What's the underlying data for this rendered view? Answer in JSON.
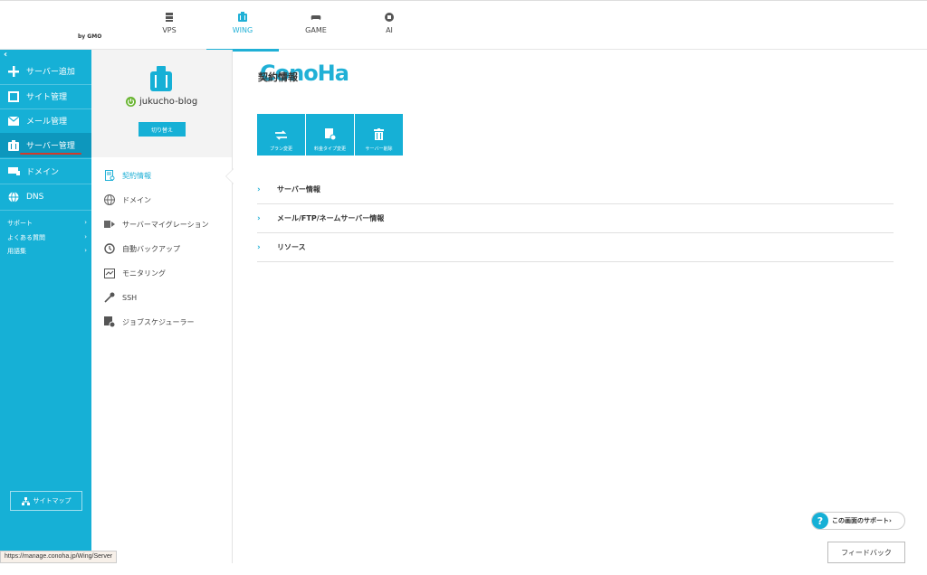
{
  "logo": {
    "text": "ConoHa",
    "sub": "by GMO"
  },
  "top_nav": [
    {
      "label": "VPS",
      "icon": "server-rack-icon"
    },
    {
      "label": "WING",
      "icon": "wing-server-icon",
      "active": true
    },
    {
      "label": "GAME",
      "icon": "gamepad-icon"
    },
    {
      "label": "AI",
      "icon": "ai-chip-icon"
    }
  ],
  "sidebar": {
    "collapse": "‹",
    "items": [
      {
        "label": "サーバー追加",
        "icon": "plus-icon"
      },
      {
        "label": "サイト管理",
        "icon": "window-icon"
      },
      {
        "label": "メール管理",
        "icon": "mail-icon"
      },
      {
        "label": "サーバー管理",
        "icon": "server-icon",
        "active": true
      },
      {
        "label": "ドメイン",
        "icon": "domain-icon"
      },
      {
        "label": "DNS",
        "icon": "globe-icon"
      }
    ],
    "links": [
      {
        "label": "サポート",
        "arrow": "›"
      },
      {
        "label": "よくある質問",
        "arrow": "›"
      },
      {
        "label": "用語集",
        "arrow": "›"
      }
    ],
    "sitemap": "サイトマップ"
  },
  "server": {
    "name": "jukucho-blog",
    "switch_label": "切り替え"
  },
  "sub_menu": [
    {
      "label": "契約情報",
      "icon": "contract-icon",
      "active": true
    },
    {
      "label": "ドメイン",
      "icon": "www-icon"
    },
    {
      "label": "サーバーマイグレーション",
      "icon": "migration-icon"
    },
    {
      "label": "自動バックアップ",
      "icon": "backup-icon"
    },
    {
      "label": "モニタリング",
      "icon": "monitor-icon"
    },
    {
      "label": "SSH",
      "icon": "key-icon"
    },
    {
      "label": "ジョブスケジューラー",
      "icon": "scheduler-icon"
    }
  ],
  "main": {
    "title": "契約情報",
    "actions": [
      {
        "label": "プラン変更",
        "icon": "swap-icon"
      },
      {
        "label": "料金タイプ変更",
        "icon": "fee-icon"
      },
      {
        "label": "サーバー削除",
        "icon": "trash-icon"
      }
    ],
    "sections": [
      {
        "label": "サーバー情報",
        "chevron": "›"
      },
      {
        "label": "メール/FTP/ネームサーバー情報",
        "chevron": "›"
      },
      {
        "label": "リソース",
        "chevron": "›"
      }
    ]
  },
  "footer": {
    "status_url": "https://manage.conoha.jp/Wing/Server",
    "support_label": "この画面のサポート",
    "support_q": "?",
    "support_arrow": "›",
    "feedback_label": "フィードバック"
  },
  "colors": {
    "accent": "#16b0d6",
    "active_bg": "#0d97bd",
    "underline": "#d43a2a",
    "power": "#6ab533"
  }
}
